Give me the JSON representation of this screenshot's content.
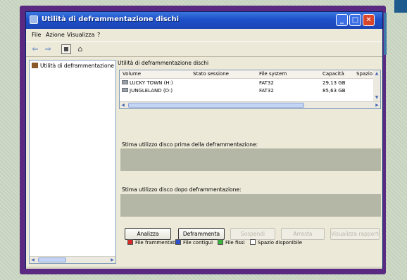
{
  "window": {
    "title": "Utilità di deframmentazione dischi",
    "buttons": {
      "minimize": "_",
      "maximize": "□",
      "close": "✕"
    }
  },
  "menu": {
    "items": [
      "File",
      "Azione",
      "Visualizza",
      "?"
    ]
  },
  "toolbar": {
    "icons": [
      "back-arrow-icon",
      "forward-arrow-icon",
      "console-tree-icon",
      "properties-icon"
    ]
  },
  "tree": {
    "item": "Utilità di deframmentazione"
  },
  "pane": {
    "header": "Utilità di deframmentazione dischi"
  },
  "volumes": {
    "columns": [
      "Volume",
      "Stato sessione",
      "File system",
      "Capacità",
      "Spazio"
    ],
    "rows": [
      {
        "volume": "LUCKY TOWN (H:)",
        "status": "",
        "fs": "FAT32",
        "capacity": "29,13 GB"
      },
      {
        "volume": "JUNGLELAND (D:)",
        "status": "",
        "fs": "FAT32",
        "capacity": "85,63 GB"
      }
    ]
  },
  "labels": {
    "before": "Stima utilizzo disco prima della deframmentazione:",
    "after": "Stima utilizzo disco dopo deframmentazione:"
  },
  "actions": {
    "analyze": "Analizza",
    "defrag": "Deframmenta",
    "pause": "Sospendi",
    "stop": "Arresta",
    "report": "Visualizza rapporto"
  },
  "legend": [
    {
      "label": "File frammentati",
      "color": "#d42a2a"
    },
    {
      "label": "File contigui",
      "color": "#3050c8"
    },
    {
      "label": "File fissi",
      "color": "#3cb43c"
    },
    {
      "label": "Spazio disponibile",
      "color": "#ffffff"
    }
  ]
}
